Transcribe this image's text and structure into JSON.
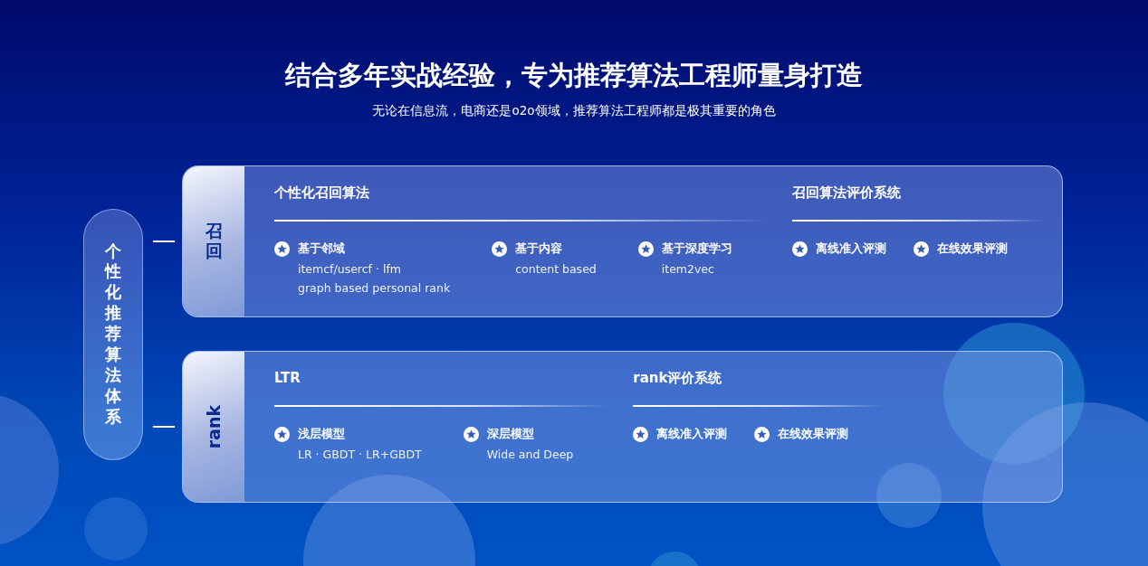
{
  "heading": {
    "title": "结合多年实战经验，专为推荐算法工程师量身打造",
    "subtitle": "无论在信息流，电商还是o2o领域，推荐算法工程师都是极其重要的角色"
  },
  "root_label": "个性化推荐算法体系",
  "cards": [
    {
      "tab": {
        "label": "召回",
        "kind": "stacked"
      },
      "sections": [
        {
          "title": "个性化召回算法",
          "items": [
            {
              "title": "基于邻域",
              "lines": [
                "itemcf/usercf · lfm",
                "graph based personal rank"
              ]
            },
            {
              "title": "基于内容",
              "lines": [
                "content based"
              ]
            },
            {
              "title": "基于深度学习",
              "lines": [
                "item2vec"
              ]
            }
          ]
        },
        {
          "title": "召回算法评价系统",
          "items": [
            {
              "title": "离线准入评测"
            },
            {
              "title": "在线效果评测"
            }
          ]
        }
      ]
    },
    {
      "tab": {
        "label": "rank",
        "kind": "rotated"
      },
      "sections": [
        {
          "title": "LTR",
          "items": [
            {
              "title": "浅层模型",
              "lines": [
                "LR · GBDT · LR+GBDT"
              ]
            },
            {
              "title": "深层模型",
              "lines": [
                "Wide and Deep"
              ]
            }
          ]
        },
        {
          "title": "rank评价系统",
          "items": [
            {
              "title": "离线准入评测"
            },
            {
              "title": "在线效果评测"
            }
          ]
        }
      ]
    }
  ]
}
